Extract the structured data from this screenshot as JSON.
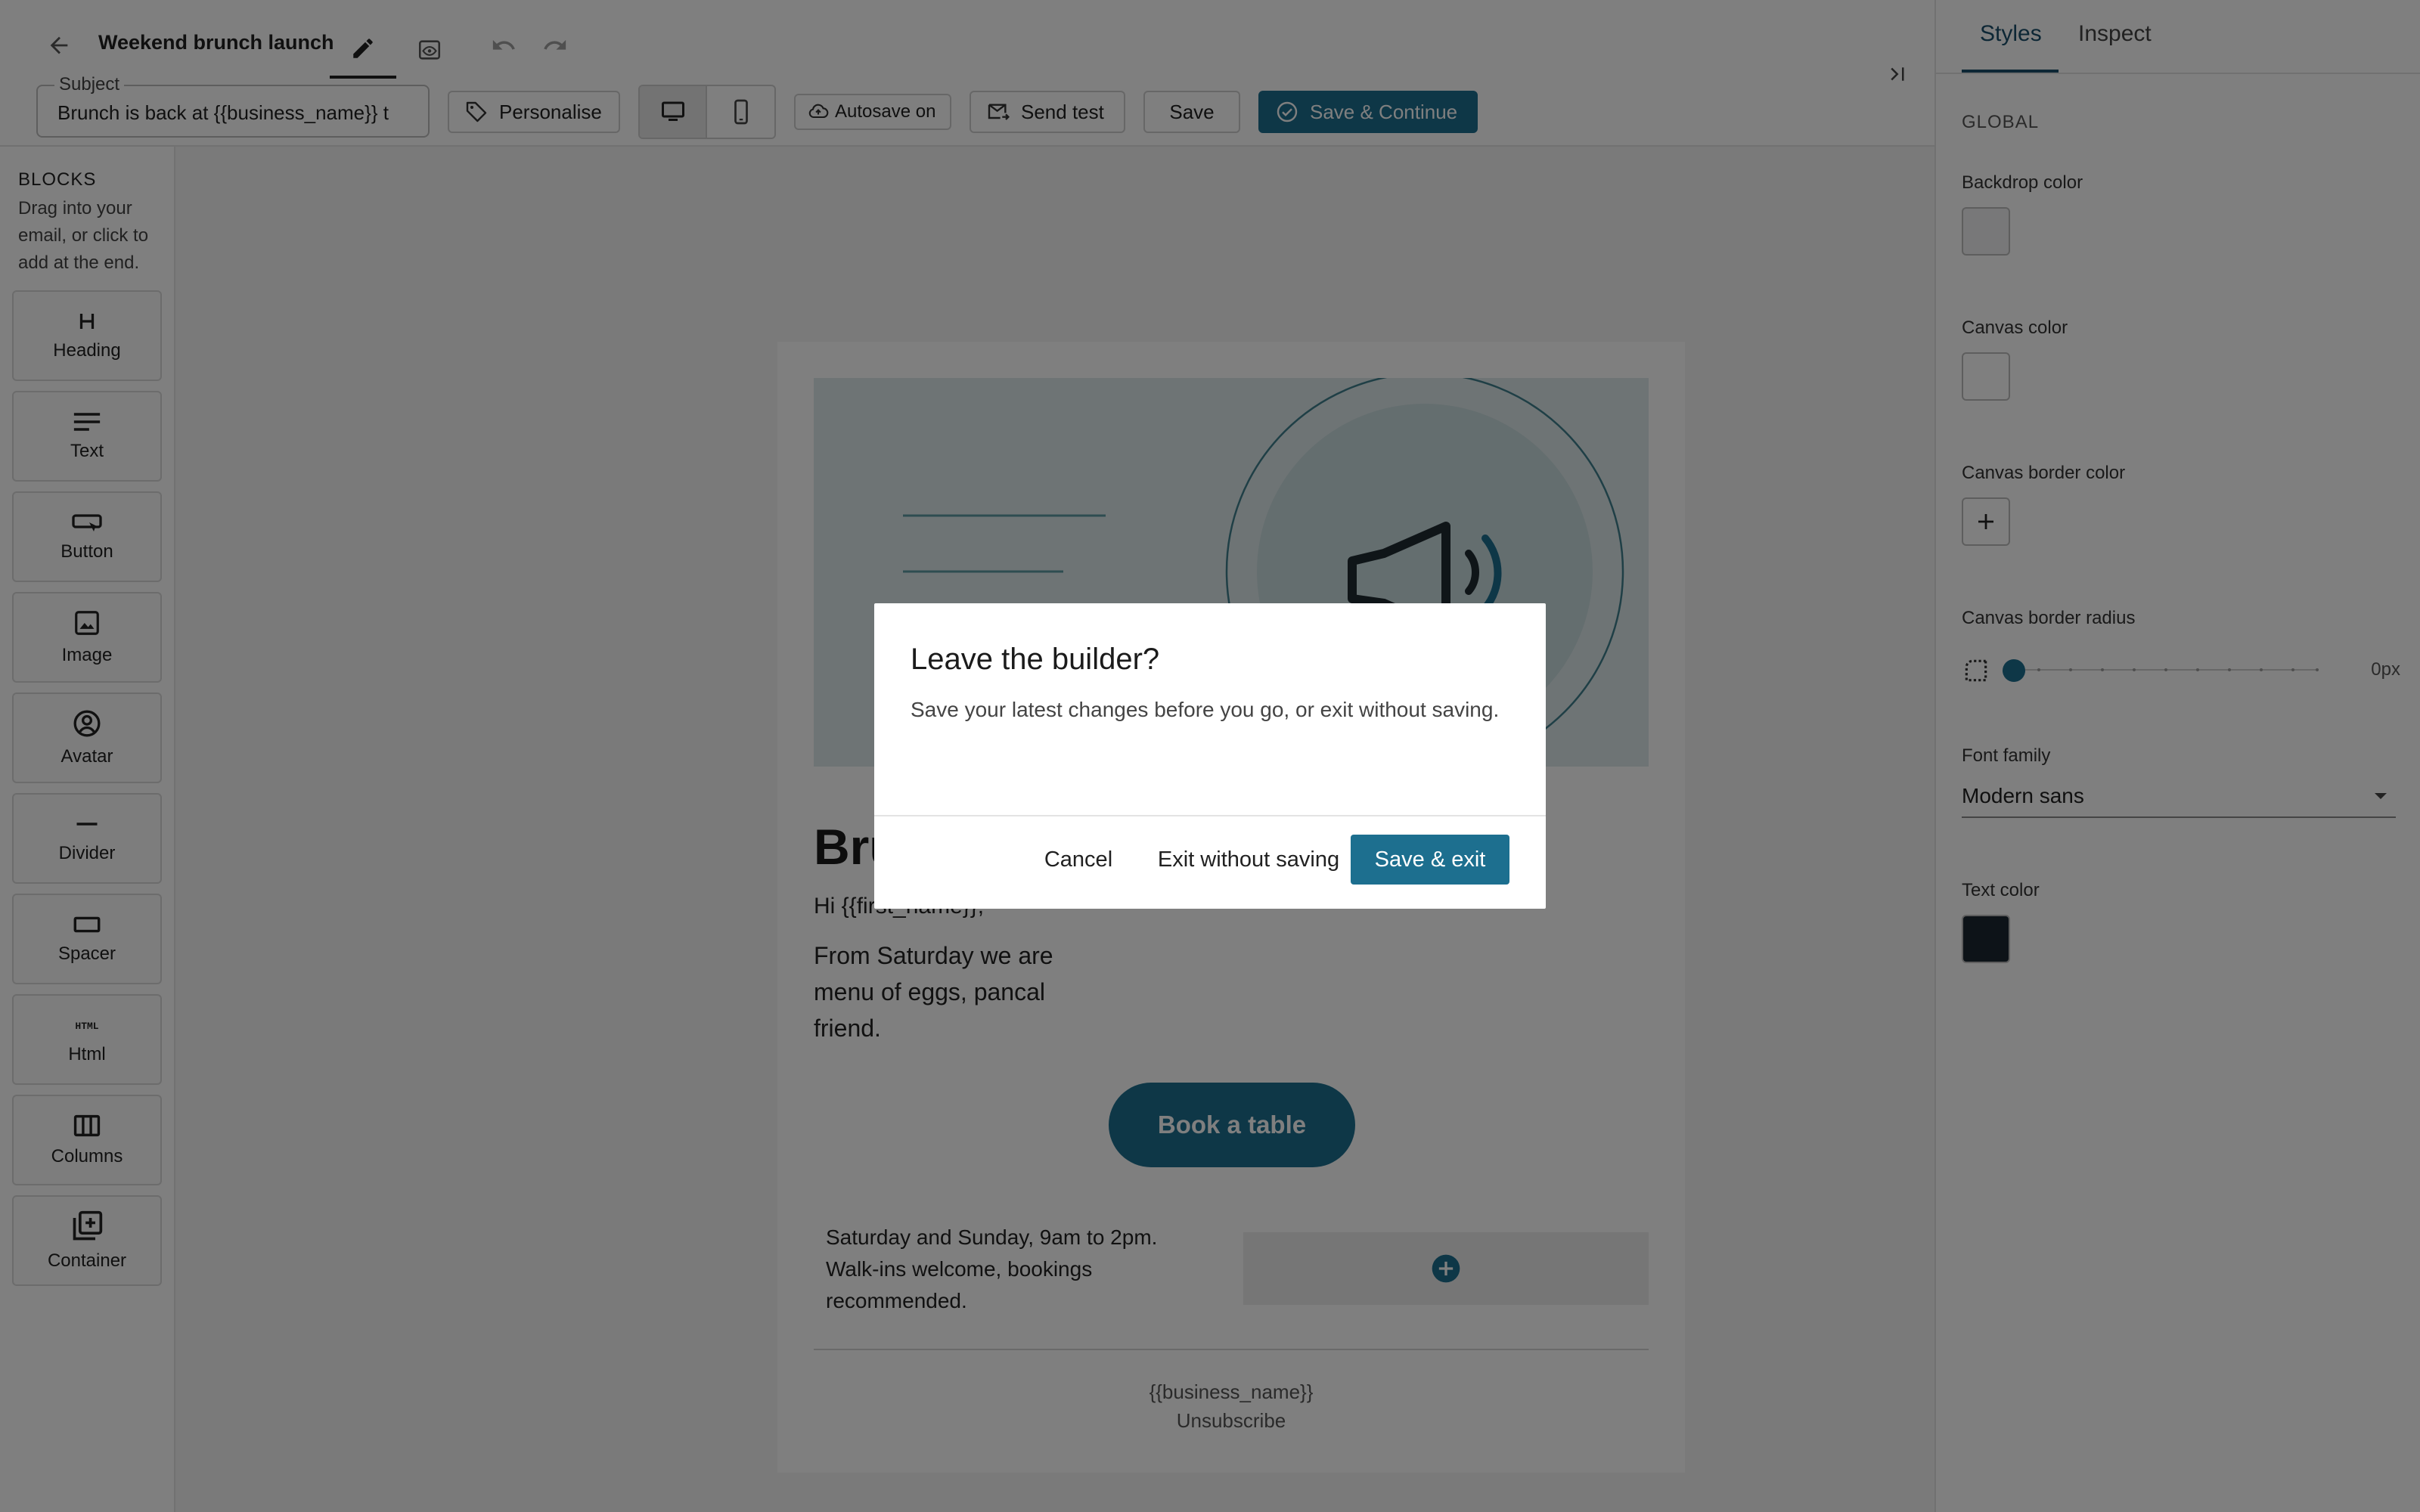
{
  "header": {
    "title": "Weekend brunch launch",
    "subject_label": "Subject",
    "subject_value": "Brunch is back at {{business_name}} t",
    "personalise_label": "Personalise",
    "autosave_label": "Autosave on",
    "send_test_label": "Send test",
    "save_label": "Save",
    "save_continue_label": "Save & Continue"
  },
  "blocks": {
    "title": "BLOCKS",
    "help": "Drag into your email, or click to add at the end.",
    "items": [
      {
        "label": "Heading",
        "icon": "heading-icon"
      },
      {
        "label": "Text",
        "icon": "text-icon"
      },
      {
        "label": "Button",
        "icon": "button-icon"
      },
      {
        "label": "Image",
        "icon": "image-icon"
      },
      {
        "label": "Avatar",
        "icon": "avatar-icon"
      },
      {
        "label": "Divider",
        "icon": "divider-icon"
      },
      {
        "label": "Spacer",
        "icon": "spacer-icon"
      },
      {
        "label": "Html",
        "icon": "html-icon"
      },
      {
        "label": "Columns",
        "icon": "columns-icon"
      },
      {
        "label": "Container",
        "icon": "container-icon"
      }
    ]
  },
  "email": {
    "heading": "Brunch is",
    "greeting": "Hi {{first_name}},",
    "body": "From Saturday we are menu of eggs, pancal friend.",
    "body_lines": [
      "From Saturday we are",
      "menu of eggs, pancal",
      "friend."
    ],
    "cta_label": "Book a table",
    "hours": "Saturday and Sunday, 9am to 2pm. Walk-ins welcome, bookings recommended.",
    "footer_name": "{{business_name}}",
    "footer_unsubscribe": "Unsubscribe"
  },
  "styles_panel": {
    "tabs": [
      "Styles",
      "Inspect"
    ],
    "section": "GLOBAL",
    "backdrop_color_label": "Backdrop color",
    "canvas_color_label": "Canvas color",
    "canvas_border_color_label": "Canvas border color",
    "canvas_border_radius_label": "Canvas border radius",
    "canvas_border_radius_value": "0px",
    "font_family_label": "Font family",
    "font_family_value": "Modern sans",
    "text_color_label": "Text color",
    "colors": {
      "backdrop": "#f0f1f3",
      "canvas": "#ffffff",
      "text": "#1a2630",
      "accent": "#1d6f8f"
    }
  },
  "dialog": {
    "title": "Leave the builder?",
    "body": "Save your latest changes before you go, or exit without saving.",
    "cancel_label": "Cancel",
    "exit_label": "Exit without saving",
    "save_exit_label": "Save & exit"
  }
}
